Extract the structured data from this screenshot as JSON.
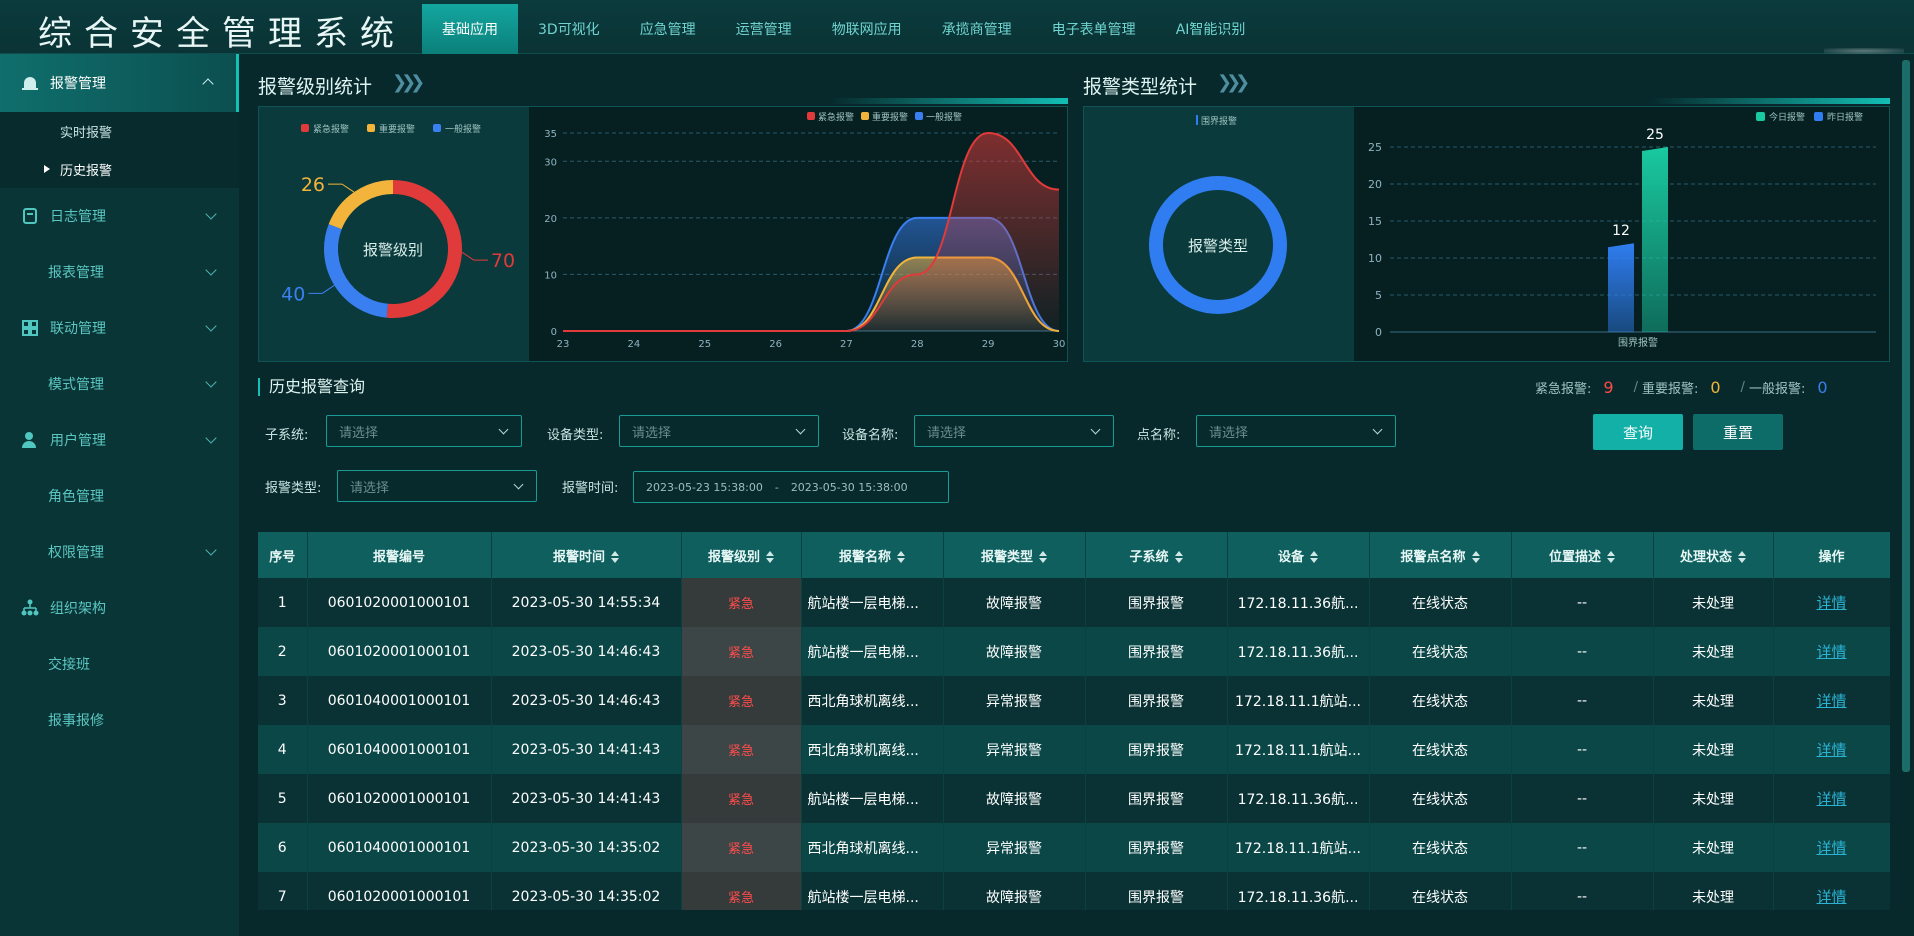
{
  "app": {
    "title": "综合安全管理系统"
  },
  "nav": {
    "tabs": [
      "基础应用",
      "3D可视化",
      "应急管理",
      "运营管理",
      "物联网应用",
      "承揽商管理",
      "电子表单管理",
      "AI智能识别"
    ],
    "active_index": 0
  },
  "sidebar": {
    "groups": [
      {
        "label": "报警管理",
        "icon": "alarm-icon",
        "active": true,
        "children": [
          "实时报警",
          "历史报警"
        ],
        "active_child": 1
      },
      {
        "label": "日志管理",
        "icon": "log-icon"
      },
      {
        "label": "报表管理",
        "sub": true
      },
      {
        "label": "联动管理",
        "icon": "linkage-icon"
      },
      {
        "label": "模式管理",
        "sub": true
      },
      {
        "label": "用户管理",
        "icon": "user-icon"
      },
      {
        "label": "角色管理",
        "sub": true,
        "no_chevron": true
      },
      {
        "label": "权限管理",
        "sub": true
      },
      {
        "label": "组织架构",
        "icon": "org-icon"
      },
      {
        "label": "交接班",
        "sub": true,
        "no_chevron": true
      },
      {
        "label": "报事报修",
        "sub": true,
        "no_chevron": true
      }
    ]
  },
  "level_stats": {
    "title": "报警级别统计",
    "donut_center": "报警级别",
    "legend": [
      "紧急报警",
      "重要报警",
      "一般报警"
    ],
    "colors": {
      "urgent": "#e03a3a",
      "important": "#f2b43a",
      "normal": "#3a7ff0"
    }
  },
  "type_stats": {
    "title": "报警类型统计",
    "donut_legend": "围界报警",
    "donut_center": "报警类型",
    "bar_legend": [
      "今日报警",
      "昨日报警"
    ],
    "colors": {
      "today": "#19c9a0",
      "yesterday": "#2f7df0"
    }
  },
  "chart_data": [
    {
      "type": "pie",
      "categories": [
        "紧急报警",
        "重要报警",
        "一般报警"
      ],
      "values": [
        70,
        26,
        40
      ],
      "colors": [
        "#e03a3a",
        "#f2b43a",
        "#3a7ff0"
      ]
    },
    {
      "type": "area",
      "x": [
        23,
        24,
        25,
        26,
        27,
        28,
        29,
        30
      ],
      "ylim": [
        0,
        35
      ],
      "yticks": [
        0,
        10,
        20,
        30,
        35
      ],
      "series": [
        {
          "name": "紧急报警",
          "values": [
            0,
            0,
            0,
            0,
            0,
            10,
            35,
            25
          ]
        },
        {
          "name": "重要报警",
          "values": [
            0,
            0,
            0,
            0,
            0,
            13,
            13,
            0
          ]
        },
        {
          "name": "一般报警",
          "values": [
            0,
            0,
            0,
            0,
            0,
            20,
            20,
            0
          ]
        }
      ],
      "grid": true,
      "legend": "top-right"
    },
    {
      "type": "pie",
      "categories": [
        "围界报警"
      ],
      "values": [
        1
      ]
    },
    {
      "type": "bar",
      "categories": [
        "围界报警"
      ],
      "series": [
        {
          "name": "昨日报警",
          "values": [
            12
          ]
        },
        {
          "name": "今日报警",
          "values": [
            25
          ]
        }
      ],
      "ylim": [
        0,
        25
      ],
      "yticks": [
        0,
        5,
        10,
        15,
        20,
        25
      ],
      "grid": true,
      "legend": "top-right"
    }
  ],
  "query": {
    "title": "历史报警查询",
    "fields": {
      "subsystem": {
        "label": "子系统:",
        "placeholder": "请选择"
      },
      "device_type": {
        "label": "设备类型:",
        "placeholder": "请选择"
      },
      "device_name": {
        "label": "设备名称:",
        "placeholder": "请选择"
      },
      "point_name": {
        "label": "点名称:",
        "placeholder": "请选择"
      },
      "alarm_type": {
        "label": "报警类型:",
        "placeholder": "请选择"
      },
      "alarm_time": {
        "label": "报警时间:",
        "start": "2023-05-23 15:38:00",
        "sep": "-",
        "end": "2023-05-30 15:38:00"
      }
    },
    "search_button": "查询",
    "reset_button": "重置",
    "counts": {
      "urgent_label": "紧急报警:",
      "urgent": "9",
      "important_label": "重要报警:",
      "important": "0",
      "normal_label": "一般报警:",
      "normal": "0"
    }
  },
  "table": {
    "headers": [
      "序号",
      "报警编号",
      "报警时间",
      "报警级别",
      "报警名称",
      "报警类型",
      "子系统",
      "设备",
      "报警点名称",
      "位置描述",
      "处理状态",
      "操作"
    ],
    "sortable": [
      false,
      false,
      true,
      true,
      true,
      true,
      true,
      true,
      true,
      true,
      true,
      false
    ],
    "rows": [
      [
        "1",
        "0601020001000101",
        "2023-05-30 14:55:34",
        "紧急",
        "航站楼一层电梯...",
        "故障报警",
        "围界报警",
        "172.18.11.36航...",
        "在线状态",
        "--",
        "未处理",
        "详情"
      ],
      [
        "2",
        "0601020001000101",
        "2023-05-30 14:46:43",
        "紧急",
        "航站楼一层电梯...",
        "故障报警",
        "围界报警",
        "172.18.11.36航...",
        "在线状态",
        "--",
        "未处理",
        "详情"
      ],
      [
        "3",
        "0601040001000101",
        "2023-05-30 14:46:43",
        "紧急",
        "西北角球机离线...",
        "异常报警",
        "围界报警",
        "172.18.11.1航站...",
        "在线状态",
        "--",
        "未处理",
        "详情"
      ],
      [
        "4",
        "0601040001000101",
        "2023-05-30 14:41:43",
        "紧急",
        "西北角球机离线...",
        "异常报警",
        "围界报警",
        "172.18.11.1航站...",
        "在线状态",
        "--",
        "未处理",
        "详情"
      ],
      [
        "5",
        "0601020001000101",
        "2023-05-30 14:41:43",
        "紧急",
        "航站楼一层电梯...",
        "故障报警",
        "围界报警",
        "172.18.11.36航...",
        "在线状态",
        "--",
        "未处理",
        "详情"
      ],
      [
        "6",
        "0601040001000101",
        "2023-05-30 14:35:02",
        "紧急",
        "西北角球机离线...",
        "异常报警",
        "围界报警",
        "172.18.11.1航站...",
        "在线状态",
        "--",
        "未处理",
        "详情"
      ],
      [
        "7",
        "0601020001000101",
        "2023-05-30 14:35:02",
        "紧急",
        "航站楼一层电梯...",
        "故障报警",
        "围界报警",
        "172.18.11.36航...",
        "在线状态",
        "--",
        "未处理",
        "详情"
      ]
    ]
  }
}
